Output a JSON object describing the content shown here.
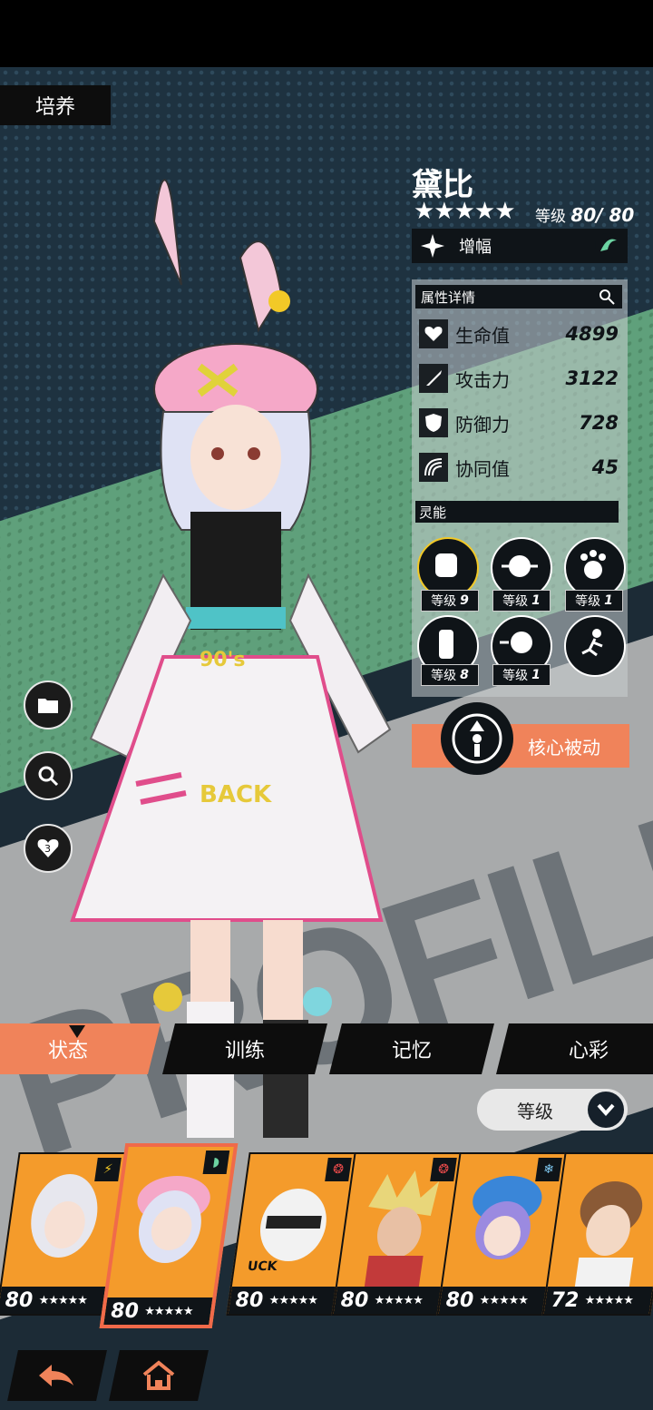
{
  "header": {
    "tab_label": "培养"
  },
  "character": {
    "name": "黛比",
    "stars": "★★★★★",
    "level_label": "等级",
    "level_value": "80/ 80",
    "amplify_label": "增幅"
  },
  "attributes": {
    "title": "属性详情",
    "stats": [
      {
        "label": "生命值",
        "value": "4899",
        "icon": "heart-icon"
      },
      {
        "label": "攻击力",
        "value": "3122",
        "icon": "sword-icon"
      },
      {
        "label": "防御力",
        "value": "728",
        "icon": "shield-icon"
      },
      {
        "label": "协同值",
        "value": "45",
        "icon": "synergy-icon"
      }
    ]
  },
  "psi": {
    "title": "灵能",
    "skills": [
      {
        "level_label": "等级",
        "level": "9",
        "icon": "fist-icon"
      },
      {
        "level_label": "等级",
        "level": "1",
        "icon": "blast-icon"
      },
      {
        "level_label": "等级",
        "level": "1",
        "icon": "paw-hand-icon"
      },
      {
        "level_label": "等级",
        "level": "8",
        "icon": "glove-icon"
      },
      {
        "level_label": "等级",
        "level": "1",
        "icon": "punch-icon"
      },
      {
        "level_label": "",
        "level": "",
        "icon": "running-figure-icon"
      }
    ]
  },
  "core_passive": {
    "label": "核心被动"
  },
  "tabs": [
    {
      "label": "状态",
      "active": true
    },
    {
      "label": "训练",
      "active": false
    },
    {
      "label": "记忆",
      "active": false
    },
    {
      "label": "心彩",
      "active": false
    }
  ],
  "sort": {
    "label": "等级"
  },
  "roster": [
    {
      "level": "80",
      "stars": "★★★★★",
      "element": "lightning",
      "selected": false,
      "color": "#f49b2b"
    },
    {
      "level": "80",
      "stars": "★★★★★",
      "element": "wind",
      "selected": true,
      "color": "#f49b2b"
    },
    {
      "level": "80",
      "stars": "★★★★★",
      "element": "fire",
      "selected": false,
      "color": "#f49b2b"
    },
    {
      "level": "80",
      "stars": "★★★★★",
      "element": "fire",
      "selected": false,
      "color": "#f49b2b"
    },
    {
      "level": "80",
      "stars": "★★★★★",
      "element": "ice",
      "selected": false,
      "color": "#f49b2b"
    },
    {
      "level": "72",
      "stars": "★★★★★",
      "element": "",
      "selected": false,
      "color": "#f49b2b"
    }
  ],
  "bottom_nav": {
    "back_icon": "back-arrow-icon",
    "home_icon": "home-icon"
  },
  "colors": {
    "accent": "#f0835a",
    "dark": "#0f1418",
    "green_band": "#5fa07b",
    "card_bg": "#f49b2b"
  }
}
